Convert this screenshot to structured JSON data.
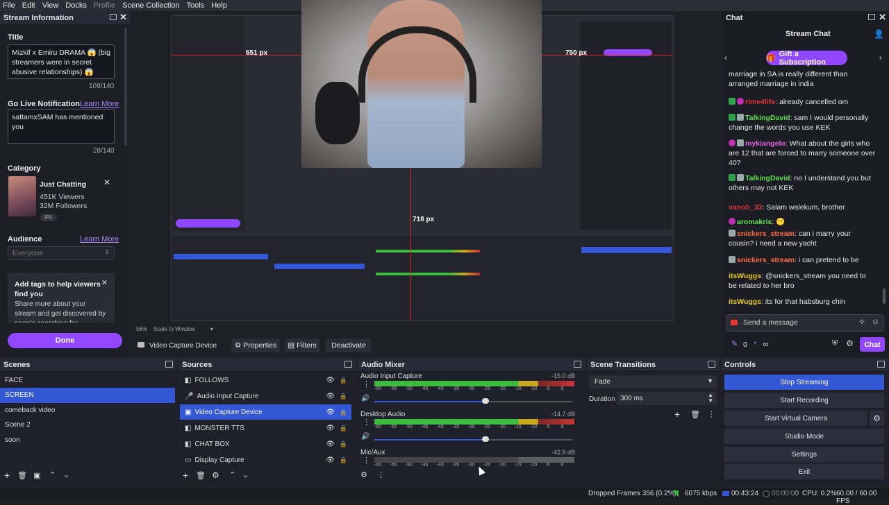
{
  "menu": [
    "File",
    "Edit",
    "View",
    "Docks",
    "Profile",
    "Scene Collection",
    "Tools",
    "Help"
  ],
  "stream_info": {
    "header": "Stream Information",
    "title_label": "Title",
    "title_value": "Mizkif x Emiru DRAMA 😱 (big streamers were in secret abusive relationships) 😱",
    "title_count": "109/140",
    "notif_label": "Go Live Notification",
    "notif_learn": "Learn More",
    "notif_value": "sattamxSAM has mentioned you",
    "notif_count": "28/140",
    "category_label": "Category",
    "category_name": "Just Chatting",
    "category_viewers": "451K Viewers",
    "category_followers": "32M Followers",
    "category_tag": "IRL",
    "audience_label": "Audience",
    "audience_learn": "Learn More",
    "audience_placeholder": "Everyone",
    "tags_title": "Add tags to help viewers find you",
    "tags_desc": "Share more about your stream and get discovered by people searching for",
    "done_label": "Done"
  },
  "preview": {
    "zoom": "56%",
    "scale": "Scale to Window",
    "measure_left": "651 px",
    "measure_right": "750 px",
    "measure_bottom": "718 px"
  },
  "source_toolbar": {
    "source_name": "Video Capture Device",
    "properties": "Properties",
    "filters": "Filters",
    "deactivate": "Deactivate"
  },
  "scenes": {
    "header": "Scenes",
    "items": [
      "FACE",
      "SCREEN",
      "comeback video",
      "Scene 2",
      "soon"
    ],
    "selected": 1
  },
  "sources": {
    "header": "Sources",
    "items": [
      "FOLLOWS",
      "Audio Input Capture",
      "Video Capture Device",
      "MONSTER TTS",
      "CHAT BOX",
      "Display Capture"
    ],
    "selected": 2
  },
  "audio_mixer": {
    "header": "Audio Mixer",
    "channels": [
      {
        "name": "Audio Input Capture",
        "db": "-15.0 dB"
      },
      {
        "name": "Desktop Audio",
        "db": "-14.7 dB"
      },
      {
        "name": "Mic/Aux",
        "db": "-42.8 dB"
      }
    ],
    "ticks": [
      "-60",
      "-55",
      "-50",
      "-45",
      "-40",
      "-35",
      "-30",
      "-25",
      "-20",
      "-15",
      "-10",
      "-5",
      "0"
    ]
  },
  "transitions": {
    "header": "Scene Transitions",
    "type": "Fade",
    "duration_label": "Duration",
    "duration_value": "300 ms"
  },
  "controls": {
    "header": "Controls",
    "stop_streaming": "Stop Streaming",
    "start_recording": "Start Recording",
    "start_virtual_camera": "Start Virtual Camera",
    "studio_mode": "Studio Mode",
    "settings": "Settings",
    "exit": "Exit"
  },
  "chat": {
    "dock_title": "Chat",
    "title": "Stream Chat",
    "gift_label": "Gift a Subscription",
    "input_placeholder": "Send a message",
    "points": "0",
    "infinity": "∞",
    "chat_button": "Chat",
    "partial_line": "marriage in SA is really different than arranged marriage in india",
    "messages": [
      {
        "user": "rime4life",
        "cls": "u-red",
        "badges": [
          "b-green",
          "b-pink"
        ],
        "text": "already cancelled om"
      },
      {
        "user": "TalkingDavid",
        "cls": "u-green",
        "badges": [
          "b-green",
          "b-gray"
        ],
        "text": "sam I would personally change the words you use KEK"
      },
      {
        "user": "mykiangelo",
        "cls": "u-pink",
        "badges": [
          "b-pink",
          "b-gray"
        ],
        "text": "What about the girls who are 12 that are forced to marry someone over 40?"
      },
      {
        "user": "TalkingDavid",
        "cls": "u-green",
        "badges": [
          "b-green",
          "b-gray"
        ],
        "text": "no I understand you but others may not KEK"
      },
      {
        "user": "vanoh_33",
        "cls": "u-red2",
        "badges": [],
        "text": "Salam walekum, brother"
      },
      {
        "user": "aromakris",
        "cls": "u-green",
        "badges": [
          "b-pink"
        ],
        "text": "😶"
      },
      {
        "user": "snickers_stream",
        "cls": "u-orange",
        "badges": [
          "b-gray"
        ],
        "text": "can i marry your cousin? i need a new yacht"
      },
      {
        "user": "snickers_stream",
        "cls": "u-orange",
        "badges": [
          "b-gray"
        ],
        "text": "i can pretend to be"
      },
      {
        "user": "itsWuggs",
        "cls": "u-yellow",
        "badges": [],
        "text": "@snickers_stream you need to be related to her bro"
      },
      {
        "user": "itsWuggs",
        "cls": "u-yellow",
        "badges": [],
        "text": "its for that habsburg chin"
      }
    ]
  },
  "status": {
    "dropped": "Dropped Frames 356 (0.2%)",
    "bitrate": "6075 kbps",
    "live_time": "00:43:24",
    "rec_time": "00:00:00",
    "cpu": "CPU: 0.2%",
    "fps": "60.00 / 60.00 FPS"
  },
  "colors": {
    "accent_purple": "#9147ff",
    "selection_blue": "#3457d5",
    "meter_green": "#3cbc3c",
    "meter_yellow": "#c8a822",
    "meter_red": "#c83232"
  }
}
